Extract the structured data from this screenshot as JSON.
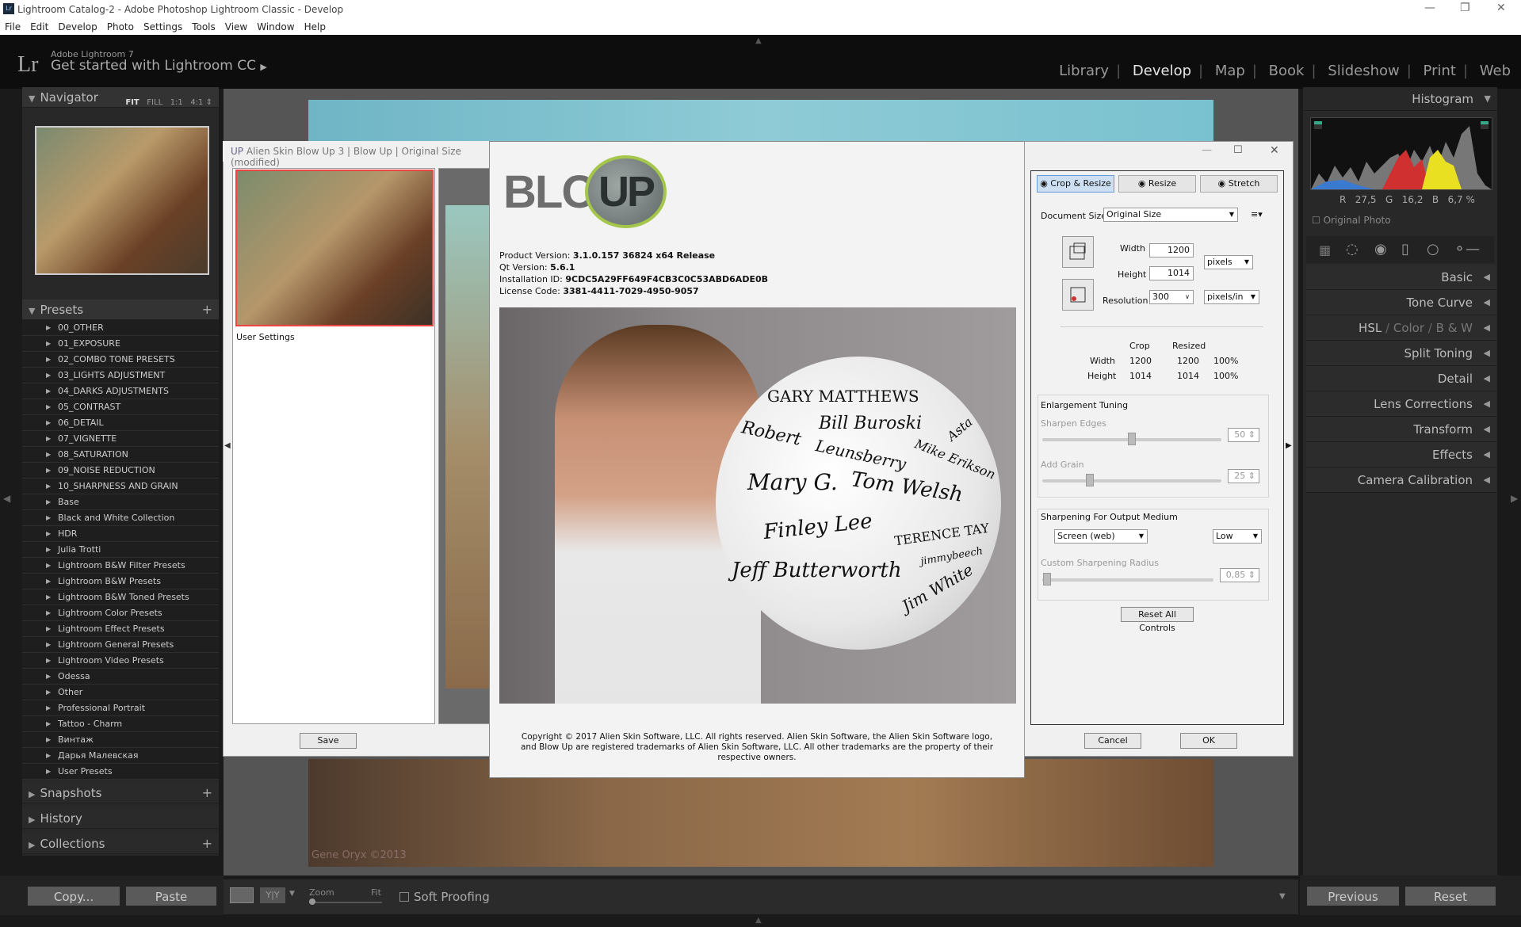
{
  "window": {
    "title": "Lightroom Catalog-2 - Adobe Photoshop Lightroom Classic - Develop"
  },
  "menu": [
    "File",
    "Edit",
    "Develop",
    "Photo",
    "Settings",
    "Tools",
    "View",
    "Window",
    "Help"
  ],
  "identity": {
    "logo": "Lr",
    "product": "Adobe Lightroom 7",
    "cta": "Get started with Lightroom CC"
  },
  "modules": {
    "items": [
      "Library",
      "Develop",
      "Map",
      "Book",
      "Slideshow",
      "Print",
      "Web"
    ],
    "active": "Develop"
  },
  "left": {
    "navigator": {
      "title": "Navigator",
      "fit": "FIT",
      "fill": "FILL",
      "one": "1:1",
      "four": "4:1"
    },
    "presets": {
      "title": "Presets",
      "items": [
        "00_OTHER",
        "01_EXPOSURE",
        "02_COMBO TONE PRESETS",
        "03_LIGHTS ADJUSTMENT",
        "04_DARKS ADJUSTMENTS",
        "05_CONTRAST",
        "06_DETAIL",
        "07_VIGNETTE",
        "08_SATURATION",
        "09_NOISE REDUCTION",
        "10_SHARPNESS AND GRAIN",
        "Base",
        "Black and White Collection",
        "HDR",
        "Julia Trotti",
        "Lightroom B&W Filter Presets",
        "Lightroom B&W Presets",
        "Lightroom B&W Toned Presets",
        "Lightroom Color Presets",
        "Lightroom Effect Presets",
        "Lightroom General Presets",
        "Lightroom Video Presets",
        "Odessa",
        "Other",
        "Professional Portrait",
        "Tattoo - Charm",
        "Винтаж",
        "Дарья Малевская",
        "User Presets"
      ]
    },
    "snapshots": "Snapshots",
    "history": "History",
    "collections": "Collections",
    "copy": "Copy...",
    "paste": "Paste"
  },
  "toolbar": {
    "zoom": "Zoom",
    "fit": "Fit",
    "soft_proofing": "Soft Proofing"
  },
  "right": {
    "histogram": "Histogram",
    "readout": {
      "r_label": "R",
      "r": "27,5",
      "g_label": "G",
      "g": "16,2",
      "b_label": "B",
      "b": "6,7",
      "pct": "%"
    },
    "original_photo": "Original Photo",
    "panels": [
      "Basic",
      "Tone Curve",
      "Split Toning",
      "Detail",
      "Lens Corrections",
      "Transform",
      "Effects",
      "Camera Calibration"
    ],
    "hsl": {
      "hsl": "HSL",
      "color": "Color",
      "bw": "B & W"
    },
    "previous": "Previous",
    "reset": "Reset"
  },
  "blowup": {
    "title": "Alien Skin Blow Up 3 | Blow Up | Original Size (modified)",
    "user_settings": "User Settings",
    "save": "Save",
    "cancel": "Cancel",
    "ok": "OK",
    "tabs": [
      "Crop & Resize",
      "Resize",
      "Stretch"
    ],
    "document_size_label": "Document Size",
    "document_size": "Original Size",
    "width_label": "Width",
    "width": "1200",
    "height_label": "Height",
    "height": "1014",
    "resolution_label": "Resolution",
    "resolution": "300",
    "units": "pixels",
    "res_units": "pixels/in",
    "table": {
      "crop": "Crop",
      "resized": "Resized",
      "rows": [
        {
          "label": "Width",
          "crop": "1200",
          "resized": "1200",
          "pct": "100%"
        },
        {
          "label": "Height",
          "crop": "1014",
          "resized": "1014",
          "pct": "100%"
        }
      ]
    },
    "enlargement_tuning": "Enlargement Tuning",
    "sharpen_edges": "Sharpen Edges",
    "sharpen_value": "50",
    "sharpen_level": 0.5,
    "add_grain": "Add Grain",
    "grain_value": "25",
    "grain_level": 0.25,
    "sharpening_output": "Sharpening For Output Medium",
    "medium": "Screen (web)",
    "amount": "Low",
    "custom_radius": "Custom Sharpening Radius",
    "radius_value": "0,85",
    "reset_all": "Reset All Controls"
  },
  "about": {
    "logo_blow": "BLOW",
    "logo_up": "UP",
    "product_version_label": "Product Version:",
    "product_version": "3.1.0.157 36824 x64 Release",
    "qt_version_label": "Qt Version:",
    "qt_version": "5.6.1",
    "installation_label": "Installation ID:",
    "installation_id": "9CDC5A29FF649F4CB3C0C53ABD6ADE0B",
    "license_label": "License Code:",
    "license_code": "3381-4411-7029-4950-9057",
    "signatures": [
      "GARY MATTHEWS",
      "Robert",
      "Bill Buroski",
      "Asta",
      "Leunsberry",
      "Mike Erikson",
      "Mary G.",
      "Tom Welsh",
      "Finley Lee",
      "TERENCE TAY",
      "jimmybeech",
      "Jeff Butterworth",
      "Jim White"
    ],
    "copyright": "Copyright © 2017 Alien Skin Software, LLC. All rights reserved. Alien Skin Software, the Alien Skin Software logo, and Blow Up are registered trademarks of Alien Skin Software, LLC. All other trademarks are the property of their respective owners."
  },
  "watermark": "Gene Oryx ©2013"
}
